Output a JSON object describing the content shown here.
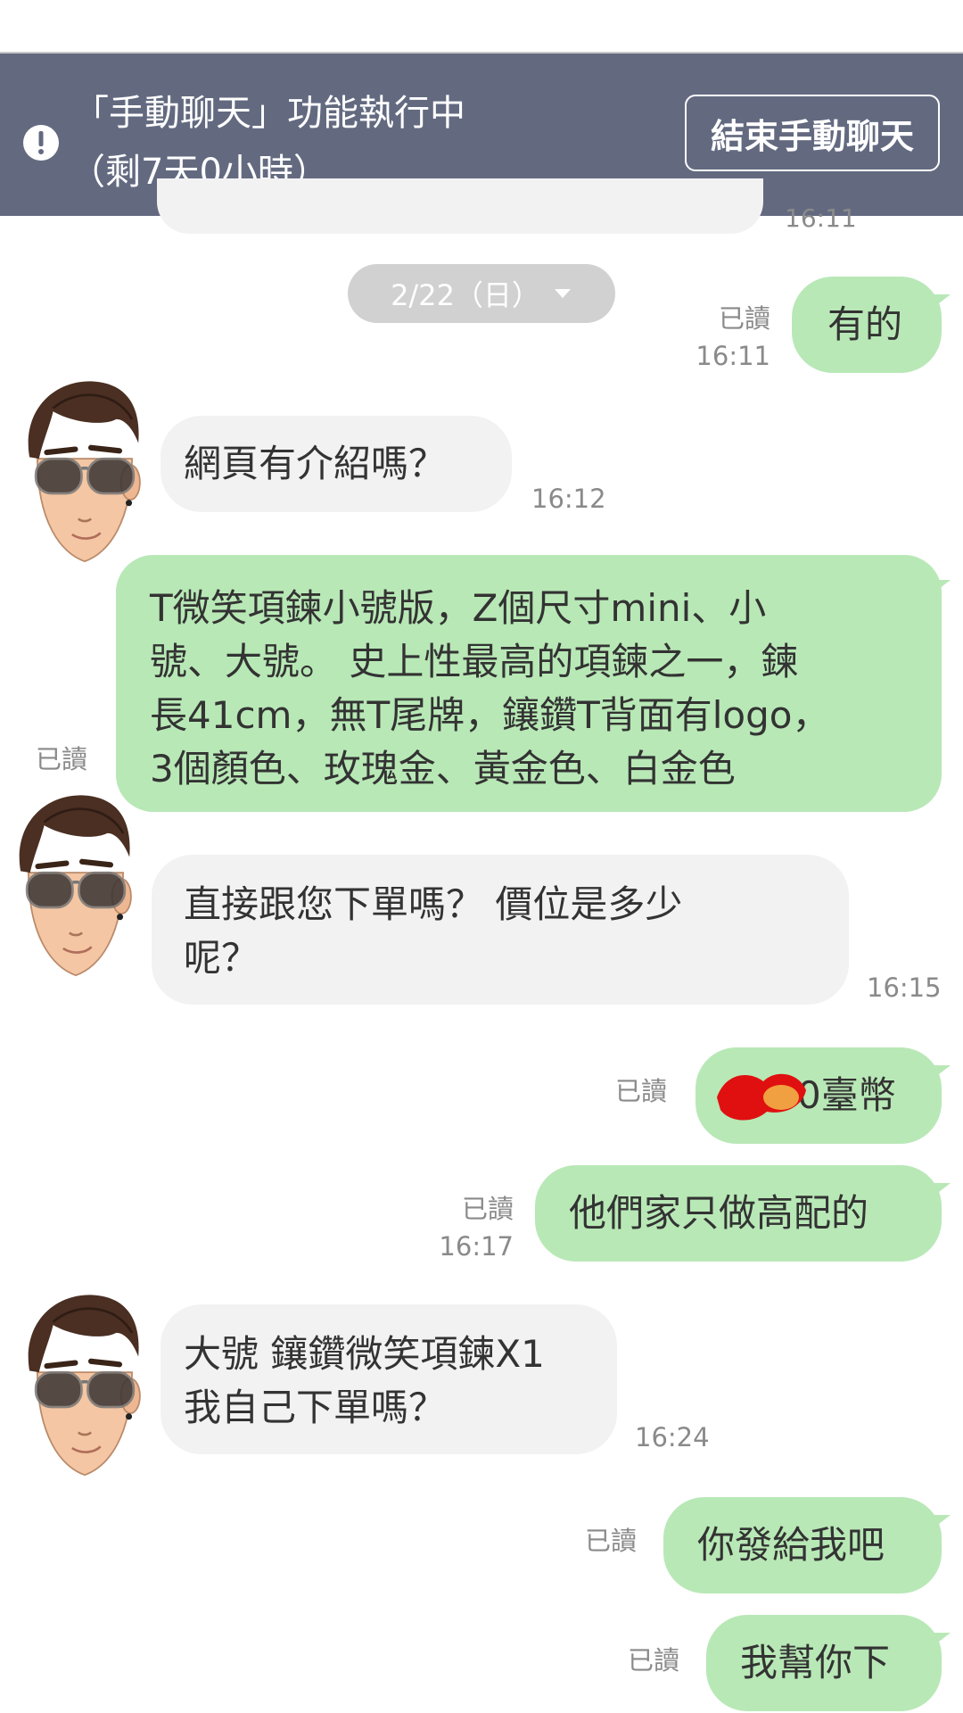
{
  "status_banner": {
    "line1": "「手動聊天」功能執行中",
    "line2": "（剩7天0小時）",
    "end_button": "結束手動聊天",
    "alert_icon": "exclamation-circle-icon"
  },
  "previous_message": {
    "time": "16:11"
  },
  "date_separator": {
    "label": "2/22（日）",
    "icon": "chevron-down-icon"
  },
  "messages": [
    {
      "side": "me",
      "text": "有的",
      "read": "已讀",
      "time": "16:11"
    },
    {
      "side": "them",
      "text": "網頁有介紹嗎？",
      "time": "16:12"
    },
    {
      "side": "me",
      "lines": [
        "T微笑項鍊小號版，Z個尺寸mini、小",
        "號、大號。 史上性最高的項鍊之一，鍊",
        "長41cm，無T尾牌，鑲鑽T背面有logo，",
        "3個顏色、玫瑰金、黃金色、白金色"
      ],
      "read": "已讀"
    },
    {
      "side": "them",
      "lines": [
        "直接跟您下單嗎？ 價位是多少",
        "呢？"
      ],
      "time": "16:15"
    },
    {
      "side": "me",
      "text": "0臺幣",
      "read": "已讀"
    },
    {
      "side": "me",
      "text": "他們家只做高配的",
      "read": "已讀",
      "time": "16:17"
    },
    {
      "side": "them",
      "lines": [
        "大號 鑲鑽微笑項鍊X1",
        "我自己下單嗎？"
      ],
      "time": "16:24"
    },
    {
      "side": "me",
      "text": "你發給我吧",
      "read": "已讀"
    },
    {
      "side": "me",
      "text": "我幫你下",
      "read": "已讀"
    }
  ],
  "colors": {
    "banner": "#636a80",
    "my_bubble": "#b8e8b6",
    "their_bubble": "#f2f2f3",
    "date_pill": "#d1d1d1"
  }
}
